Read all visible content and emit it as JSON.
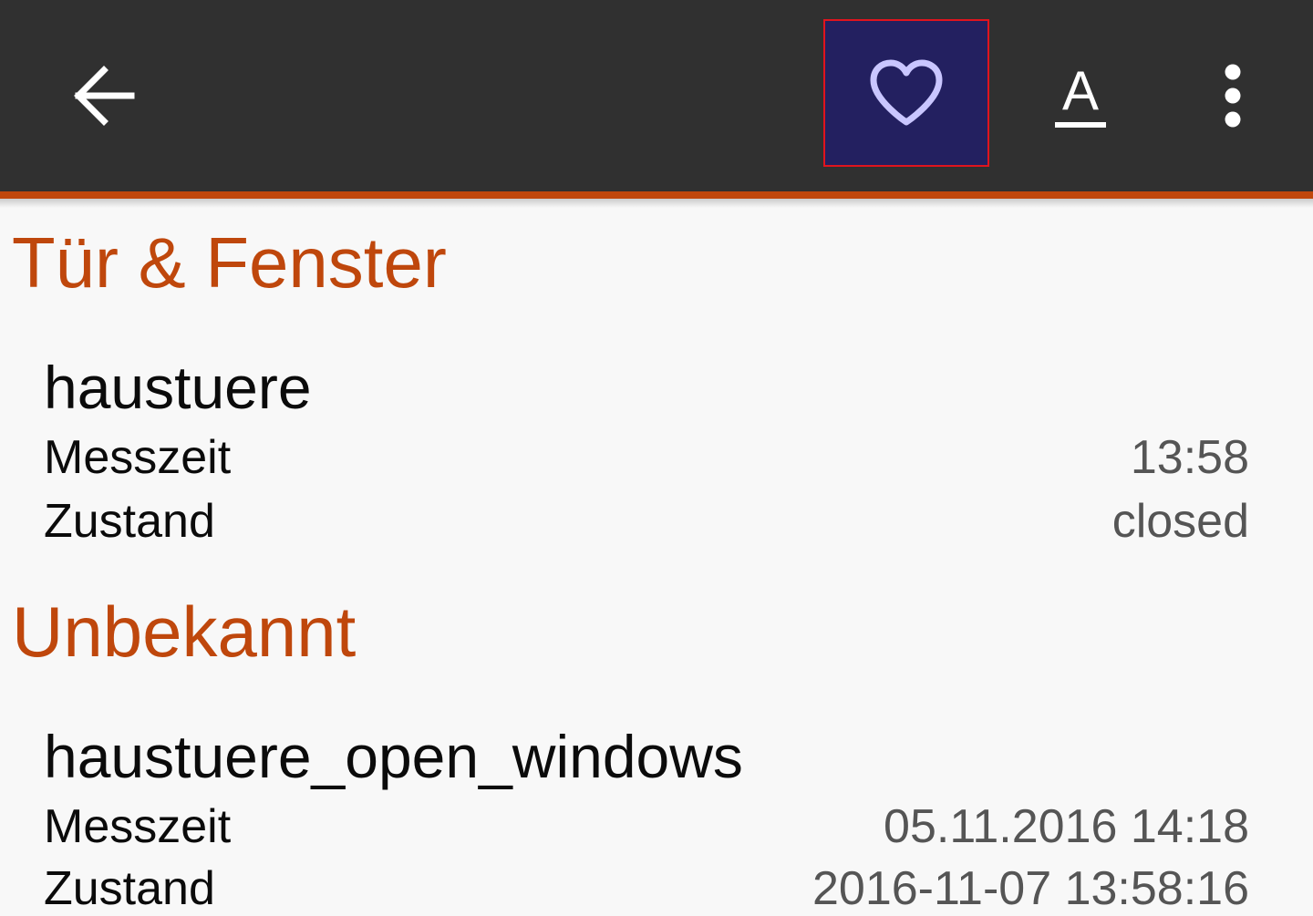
{
  "toolbar": {
    "back_icon": "arrow-left-icon",
    "favorite_icon": "heart-outline-icon",
    "font_icon": "text-format-icon",
    "font_label": "A",
    "more_icon": "more-vertical-icon",
    "background_color": "#303030",
    "accent_color": "#c0470c",
    "favorite_highlight_color": "#232060"
  },
  "sections": [
    {
      "title": "Tür & Fenster",
      "devices": [
        {
          "name": "haustuere",
          "rows": [
            {
              "label": "Messzeit",
              "value": "13:58"
            },
            {
              "label": "Zustand",
              "value": "closed"
            }
          ]
        }
      ]
    },
    {
      "title": "Unbekannt",
      "devices": [
        {
          "name": "haustuere_open_windows",
          "rows": [
            {
              "label": "Messzeit",
              "value": "05.11.2016 14:18"
            },
            {
              "label": "Zustand",
              "value": "2016-11-07 13:58:16"
            }
          ]
        }
      ]
    }
  ]
}
